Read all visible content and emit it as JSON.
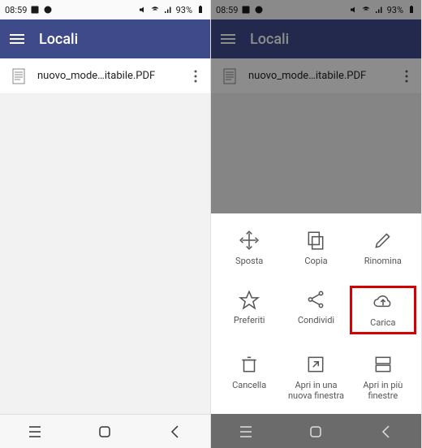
{
  "status": {
    "time": "08:59",
    "battery": "93%"
  },
  "appbar": {
    "title": "Locali"
  },
  "file": {
    "name": "nuovo_mode…itabile.PDF"
  },
  "actions": {
    "move": "Sposta",
    "copy": "Copia",
    "rename": "Rinomina",
    "favorites": "Preferiti",
    "share": "Condividi",
    "upload": "Carica",
    "delete": "Cancella",
    "newwin": "Apri in una nuova finestra",
    "multiwin": "Apri in più finestre"
  }
}
